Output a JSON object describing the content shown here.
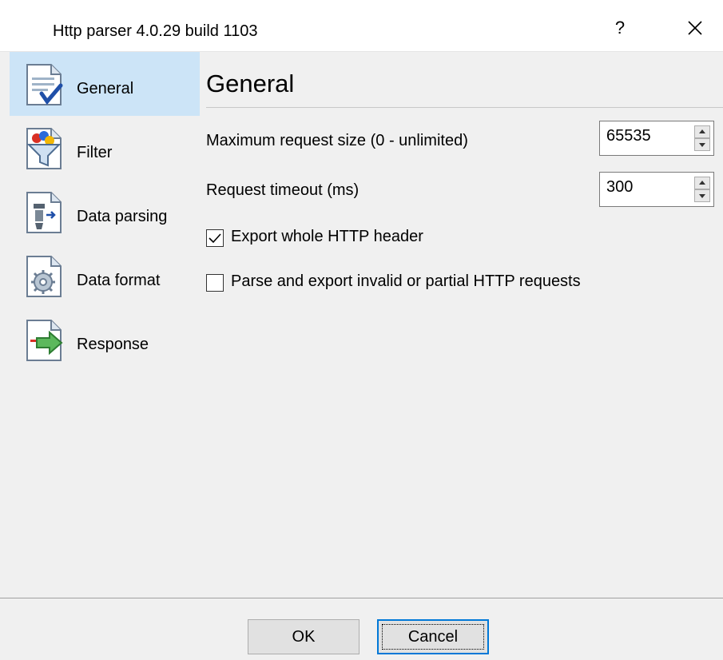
{
  "window": {
    "title": "Http parser 4.0.29 build 1103",
    "help_label": "?",
    "close_icon": "close-icon"
  },
  "sidebar": {
    "items": [
      {
        "label": "General",
        "icon": "document-check-icon",
        "selected": true
      },
      {
        "label": "Filter",
        "icon": "funnel-icon",
        "selected": false
      },
      {
        "label": "Data parsing",
        "icon": "document-parse-icon",
        "selected": false
      },
      {
        "label": "Data format",
        "icon": "document-gear-icon",
        "selected": false
      },
      {
        "label": "Response",
        "icon": "document-arrow-icon",
        "selected": false
      }
    ]
  },
  "panel": {
    "title": "General",
    "fields": [
      {
        "label": "Maximum request size (0 - unlimited)",
        "value": "65535"
      },
      {
        "label": "Request timeout (ms)",
        "value": "300"
      }
    ],
    "checkboxes": [
      {
        "label": "Export whole HTTP header",
        "checked": true
      },
      {
        "label": "Parse and export invalid or partial HTTP requests",
        "checked": false
      }
    ]
  },
  "footer": {
    "ok_label": "OK",
    "cancel_label": "Cancel"
  },
  "colors": {
    "selection": "#cce4f7",
    "accent": "#0078d7",
    "client_bg": "#f0f0f0"
  }
}
